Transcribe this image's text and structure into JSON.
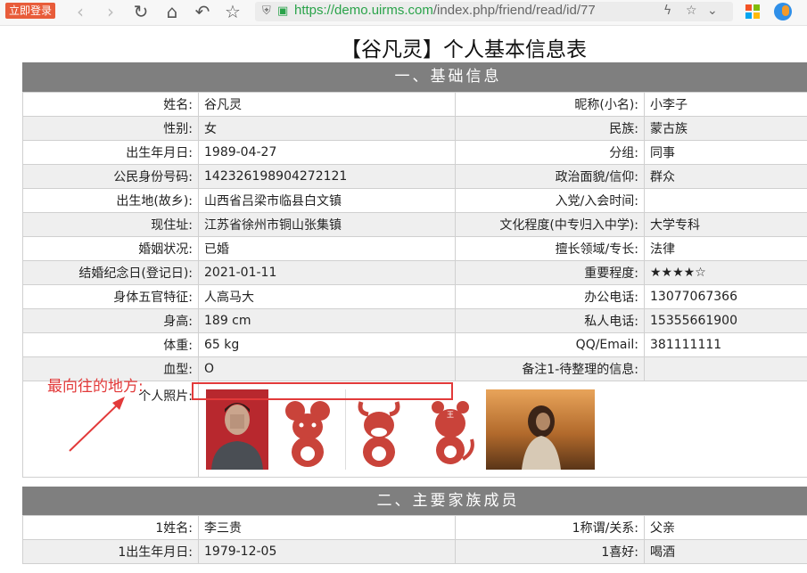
{
  "browser": {
    "login_button": "立即登录",
    "url_host": "https://demo.uirms.com",
    "url_path": "/index.php/friend/read/id/77"
  },
  "page": {
    "title": "【谷凡灵】个人基本信息表",
    "section1": "一、基础信息",
    "section2": "二、主要家族成员"
  },
  "rows": [
    {
      "l1": "姓名:",
      "v1": "谷凡灵",
      "l2": "昵称(小名):",
      "v2": "小李子"
    },
    {
      "l1": "性别:",
      "v1": "女",
      "l2": "民族:",
      "v2": "蒙古族"
    },
    {
      "l1": "出生年月日:",
      "v1": "1989-04-27",
      "l2": "分组:",
      "v2": "同事"
    },
    {
      "l1": "公民身份号码:",
      "v1": "142326198904272121",
      "l2": "政治面貌/信仰:",
      "v2": "群众"
    },
    {
      "l1": "出生地(故乡):",
      "v1": "山西省吕梁市临县白文镇",
      "l2": "入党/入会时间:",
      "v2": ""
    },
    {
      "l1": "现住址:",
      "v1": "江苏省徐州市铜山张集镇",
      "l2": "文化程度(中专归入中学):",
      "v2": "大学专科"
    },
    {
      "l1": "婚姻状况:",
      "v1": "已婚",
      "l2": "擅长领域/专长:",
      "v2": "法律"
    },
    {
      "l1": "结婚纪念日(登记日):",
      "v1": "2021-01-11",
      "l2": "重要程度:",
      "v2": "★★★★☆"
    },
    {
      "l1": "身体五官特征:",
      "v1": "人高马大",
      "l2": "办公电话:",
      "v2": "13077067366"
    },
    {
      "l1": "身高:",
      "v1": "189 cm",
      "l2": "私人电话:",
      "v2": "15355661900"
    },
    {
      "l1": "体重:",
      "v1": "65 kg",
      "l2": "QQ/Email:",
      "v2": "381111111"
    },
    {
      "l1": "血型:",
      "v1": "O",
      "l2": "备注1-待整理的信息:",
      "v2": ""
    }
  ],
  "photo_label": "个人照片:",
  "family_rows": [
    {
      "l1": "1姓名:",
      "v1": "李三贵",
      "l2": "1称谓/关系:",
      "v2": "父亲"
    },
    {
      "l1": "1出生年月日:",
      "v1": "1979-12-05",
      "l2": "1喜好:",
      "v2": "喝酒"
    }
  ],
  "annotation": "最向往的地方:",
  "colors": {
    "section_bar": "#7f7f7f",
    "accent_red": "#e23a3a",
    "url_green": "#2aa34a"
  }
}
